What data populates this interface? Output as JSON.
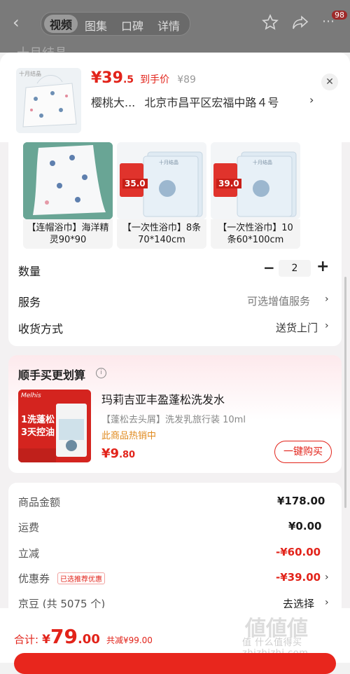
{
  "topbar": {
    "back_icon": "chevron-left-icon",
    "tabs": [
      "视频",
      "图集",
      "口碑",
      "详情"
    ],
    "active_tab": 0,
    "badge": "98",
    "under_text": "十月结晶"
  },
  "product": {
    "price_main": "¥39",
    "price_dec": ".5",
    "price_tag": "到手价",
    "orig_price": "¥89",
    "address_name": "樱桃大...",
    "address": "北京市昌平区宏福中路４号",
    "thumb_label": "十月结晶"
  },
  "options": [
    {
      "label": "【连帽浴巾】海洋精灵90*90"
    },
    {
      "label": "【一次性浴巾】8条70*140cm",
      "price_badge": "35.0",
      "brand": "十月结晶"
    },
    {
      "label": "【一次性浴巾】10条60*100cm",
      "price_badge": "39.0",
      "brand": "十月结晶"
    }
  ],
  "quantity": {
    "label": "数量",
    "value": "2",
    "minus": "−",
    "plus": "+"
  },
  "service": {
    "label": "服务",
    "value": "可选增值服务"
  },
  "delivery": {
    "label": "收货方式",
    "value": "送货上门"
  },
  "upsell": {
    "title": "顺手买更划算",
    "product_name": "玛莉吉亚丰盈蓬松洗发水",
    "spec": "【蓬松去头屑】洗发乳旅行装 10ml",
    "hot": "此商品热销中",
    "price_main": "¥9",
    "price_dec": ".80",
    "buy_label": "一键购买",
    "img_brand": "Melhis",
    "img_line1": "1洗蓬松",
    "img_line2": "3天控油"
  },
  "summary": {
    "rows": [
      {
        "label": "商品金额",
        "value": "¥178.00"
      },
      {
        "label": "运费",
        "value": "¥0.00"
      },
      {
        "label": "立减",
        "value": "-¥60.00"
      },
      {
        "label": "优惠券",
        "tag": "已选推荐优惠",
        "value": "-¥39.00"
      },
      {
        "label": "京豆 (共 5075 个)",
        "value": "去选择"
      }
    ]
  },
  "footer": {
    "total_label": "合计:",
    "total_currency": "¥",
    "total_main": "79",
    "total_dec": ".00",
    "saved": "共减¥99.00"
  },
  "watermark": "值 什么值得买 zhizhizhi.com",
  "colors": {
    "accent": "#e2231a",
    "upsell_bg": "#fdecef"
  }
}
